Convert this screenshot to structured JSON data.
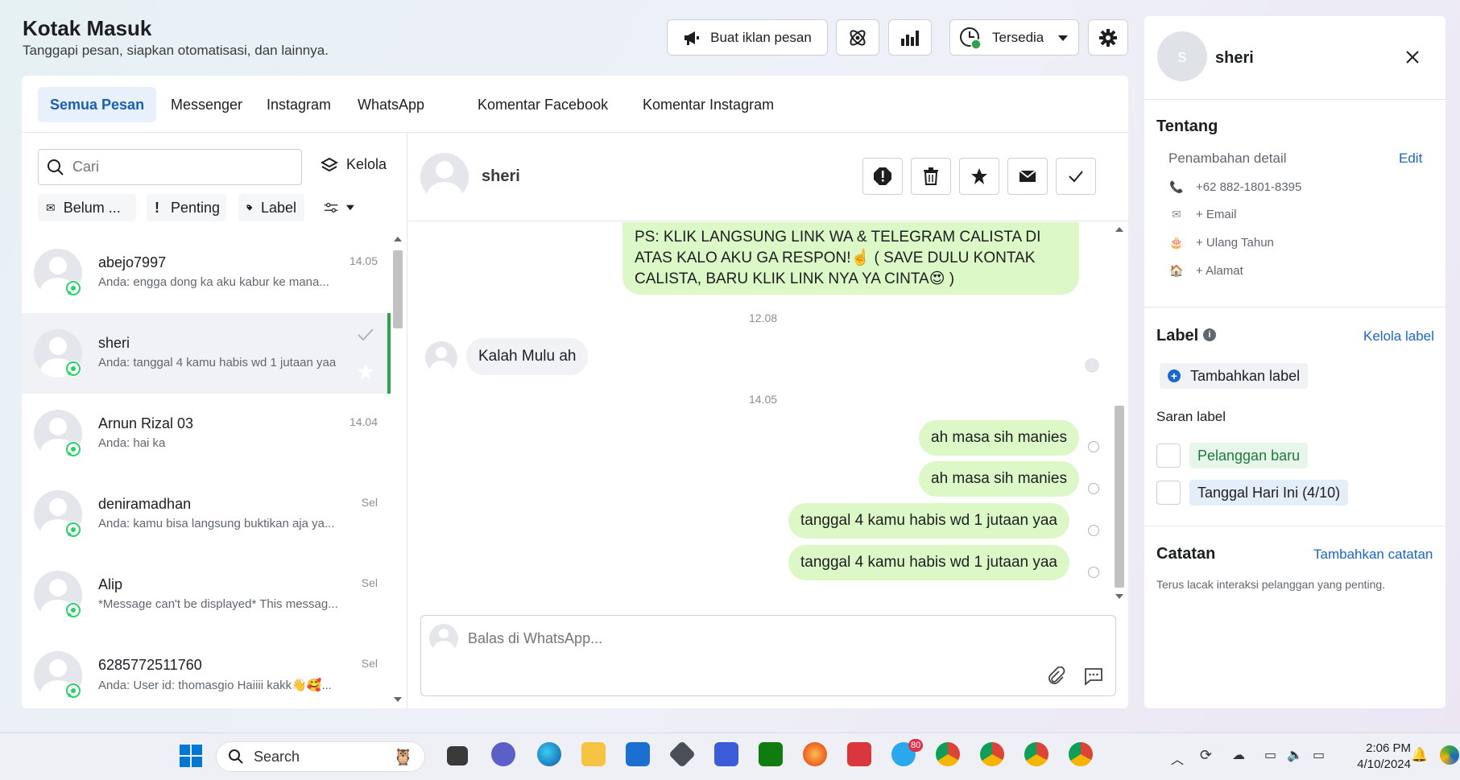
{
  "header": {
    "title": "Kotak Masuk",
    "subtitle": "Tanggapi pesan, siapkan otomatisasi, dan lainnya.",
    "ad_button": "Buat iklan pesan",
    "status_button": "Tersedia"
  },
  "tabs": [
    "Semua Pesan",
    "Messenger",
    "Instagram",
    "WhatsApp",
    "Komentar Facebook",
    "Komentar Instagram"
  ],
  "list": {
    "search_placeholder": "Cari",
    "manage_label": "Kelola",
    "filters": [
      "Belum ...",
      "Penting",
      "Label"
    ],
    "conversations": [
      {
        "name": "abejo7997",
        "preview": "Anda: engga dong ka aku kabur ke mana...",
        "time": "14.05"
      },
      {
        "name": "sheri",
        "preview": "Anda: tanggal 4 kamu habis wd 1 jutaan yaa",
        "time": ""
      },
      {
        "name": "Arnun Rizal 03",
        "preview": "Anda: hai ka",
        "time": "14.04"
      },
      {
        "name": "deniramadhan",
        "preview": "Anda: kamu bisa langsung buktikan aja ya...",
        "time": "Sel"
      },
      {
        "name": "Alip",
        "preview": "*Message can't be displayed* This messag...",
        "time": "Sel"
      },
      {
        "name": "6285772511760",
        "preview": "Anda: User id: thomasgio Haiiii kakk👋🥰...",
        "time": "Sel"
      }
    ]
  },
  "chat": {
    "contact_name": "sheri",
    "messages": {
      "top_out_1": "PS: KLIK LANGSUNG LINK  WA & TELEGRAM CALISTA DI",
      "top_out_2": "ATAS KALO AKU GA RESPON!☝️ ( SAVE DULU KONTAK",
      "top_out_3": "CALISTA, BARU KLIK LINK NYA YA CINTA😍 )",
      "time_1": "12.08",
      "in_1": "Kalah Mulu ah",
      "time_2": "14.05",
      "out_1": "ah masa sih manies",
      "out_2": "ah masa sih manies",
      "out_3": "tanggal 4 kamu habis wd 1 jutaan yaa",
      "out_4": "tanggal 4 kamu habis wd 1 jutaan yaa"
    },
    "reply_placeholder": "Balas di WhatsApp..."
  },
  "contact_panel": {
    "avatar_initial": "s",
    "name": "sheri",
    "about_title": "Tentang",
    "details_label": "Penambahan detail",
    "edit_link": "Edit",
    "phone": "+62 882-1801-8395",
    "email": "+ Email",
    "birthday": "+ Ulang Tahun",
    "address": "+ Alamat",
    "label_title": "Label",
    "manage_labels": "Kelola label",
    "add_label": "Tambahkan label",
    "suggest_title": "Saran label",
    "suggest_1": "Pelanggan baru",
    "suggest_2": "Tanggal Hari Ini (4/10)",
    "notes_title": "Catatan",
    "add_note": "Tambahkan catatan",
    "notes_desc": "Terus lacak interaksi pelanggan yang penting."
  },
  "taskbar": {
    "search": "Search",
    "time": "2:06 PM",
    "date": "4/10/2024",
    "telegram_badge": "80"
  }
}
